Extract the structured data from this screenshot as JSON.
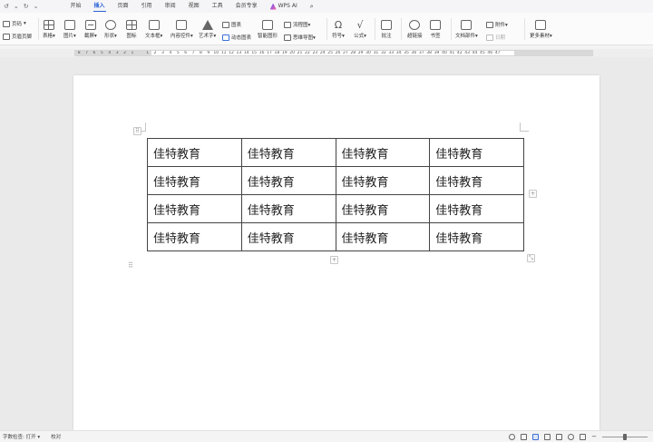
{
  "menu": {
    "quick_access": [
      "↺",
      "⌄",
      "↻",
      "⌄"
    ],
    "tabs": [
      "开始",
      "插入",
      "页面",
      "引用",
      "审阅",
      "视图",
      "工具",
      "会员专享"
    ],
    "active_tab": "插入",
    "wps_ai": "WPS AI"
  },
  "ribbon": {
    "page_number": "页码",
    "header_footer": "页眉页脚",
    "table": "表格",
    "picture": "图片",
    "screenshot": "截屏",
    "shape": "形状",
    "icon": "图标",
    "textbox": "文本框",
    "content_control": "内容控件",
    "art_text": "艺术字",
    "chart": "图表",
    "dynamic_chart": "动态图表",
    "smart_graphic": "智能图形",
    "flowchart": "流程图",
    "mindmap": "思维导图",
    "symbol": "符号",
    "formula": "公式",
    "comment": "批注",
    "hyperlink": "超链接",
    "bookmark": "书签",
    "doc_parts": "文档部件",
    "attachment": "附件",
    "date": "日期",
    "more_materials": "更多素材",
    "dropdown_glyph": "▾"
  },
  "ruler": {
    "numbers": [
      "8",
      "7",
      "6",
      "5",
      "4",
      "3",
      "2",
      "1",
      "",
      "1",
      "2",
      "3",
      "4",
      "5",
      "6",
      "7",
      "8",
      "9",
      "10",
      "11",
      "12",
      "13",
      "14",
      "15",
      "16",
      "17",
      "18",
      "19",
      "20",
      "21",
      "22",
      "23",
      "24",
      "25",
      "26",
      "27",
      "28",
      "29",
      "30",
      "31",
      "32",
      "33",
      "34",
      "35",
      "36",
      "37",
      "38",
      "39",
      "40",
      "41",
      "42",
      "43",
      "44",
      "45",
      "46",
      "47"
    ]
  },
  "table": {
    "rows": [
      [
        "佳特教育",
        "佳特教育",
        "佳特教育",
        "佳特教育"
      ],
      [
        "佳特教育",
        "佳特教育",
        "佳特教育",
        "佳特教育"
      ],
      [
        "佳特教育",
        "佳特教育",
        "佳特教育",
        "佳特教育"
      ],
      [
        "佳特教育",
        "佳特教育",
        "佳特教育",
        "佳特教育"
      ]
    ],
    "add_glyph": "+",
    "move_glyph": "⠿"
  },
  "status": {
    "word_count": "字数检查: 打开",
    "proofread": "校对",
    "zoom_fraction": 0.5
  },
  "colors": {
    "accent": "#2b63d8"
  }
}
